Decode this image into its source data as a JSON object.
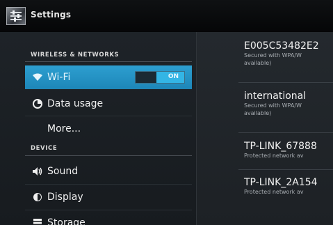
{
  "app": {
    "title": "Settings"
  },
  "sidebar": {
    "sections": [
      {
        "header": "WIRELESS & NETWORKS"
      },
      {
        "header": "DEVICE"
      }
    ],
    "items": [
      {
        "label": "Wi-Fi",
        "icon": "wifi-icon",
        "toggle_state": "ON",
        "selected": true
      },
      {
        "label": "Data usage",
        "icon": "data-usage-icon"
      },
      {
        "label": "More..."
      },
      {
        "label": "Sound",
        "icon": "speaker-icon"
      },
      {
        "label": "Display",
        "icon": "brightness-icon"
      },
      {
        "label": "Storage",
        "icon": "storage-icon"
      }
    ]
  },
  "wifi_list": {
    "networks": [
      {
        "ssid": "E005C53482E2",
        "security_line1": "Secured with WPA/W",
        "security_line2": "available)"
      },
      {
        "ssid": "international",
        "security_line1": "Secured with WPA/W",
        "security_line2": "available)"
      },
      {
        "ssid": "TP-LINK_67888",
        "security_line1": "Protected network av"
      },
      {
        "ssid": "TP-LINK_2A154",
        "security_line1": "Protected network av"
      }
    ]
  },
  "colors": {
    "accent": "#33b5e5",
    "selected_row": "#2196c9"
  }
}
